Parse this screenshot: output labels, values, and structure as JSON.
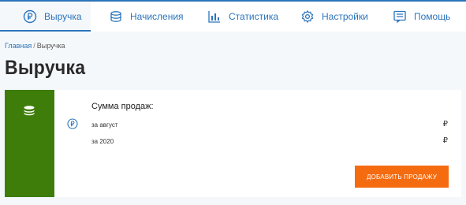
{
  "nav": {
    "items": [
      {
        "label": "Выручка",
        "icon": "ruble-circle-icon",
        "active": true
      },
      {
        "label": "Начисления",
        "icon": "coins-stack-icon",
        "active": false
      },
      {
        "label": "Статистика",
        "icon": "bar-chart-icon",
        "active": false
      },
      {
        "label": "Настройки",
        "icon": "gear-icon",
        "active": false
      },
      {
        "label": "Помощь",
        "icon": "help-list-icon",
        "active": false
      }
    ]
  },
  "breadcrumb": {
    "home": "Главная",
    "separator": "/",
    "current": "Выручка"
  },
  "page": {
    "title": "Выручка"
  },
  "sales": {
    "heading": "Сумма продаж:",
    "rows": [
      {
        "label": "за август",
        "value": "₽"
      },
      {
        "label": "за 2020",
        "value": "₽"
      }
    ],
    "add_button_label": "Добавить продажу"
  },
  "colors": {
    "accent": "#2c74bb",
    "card_side": "#3f7d0a",
    "button": "#f46b10",
    "background": "#f5f8fb"
  }
}
